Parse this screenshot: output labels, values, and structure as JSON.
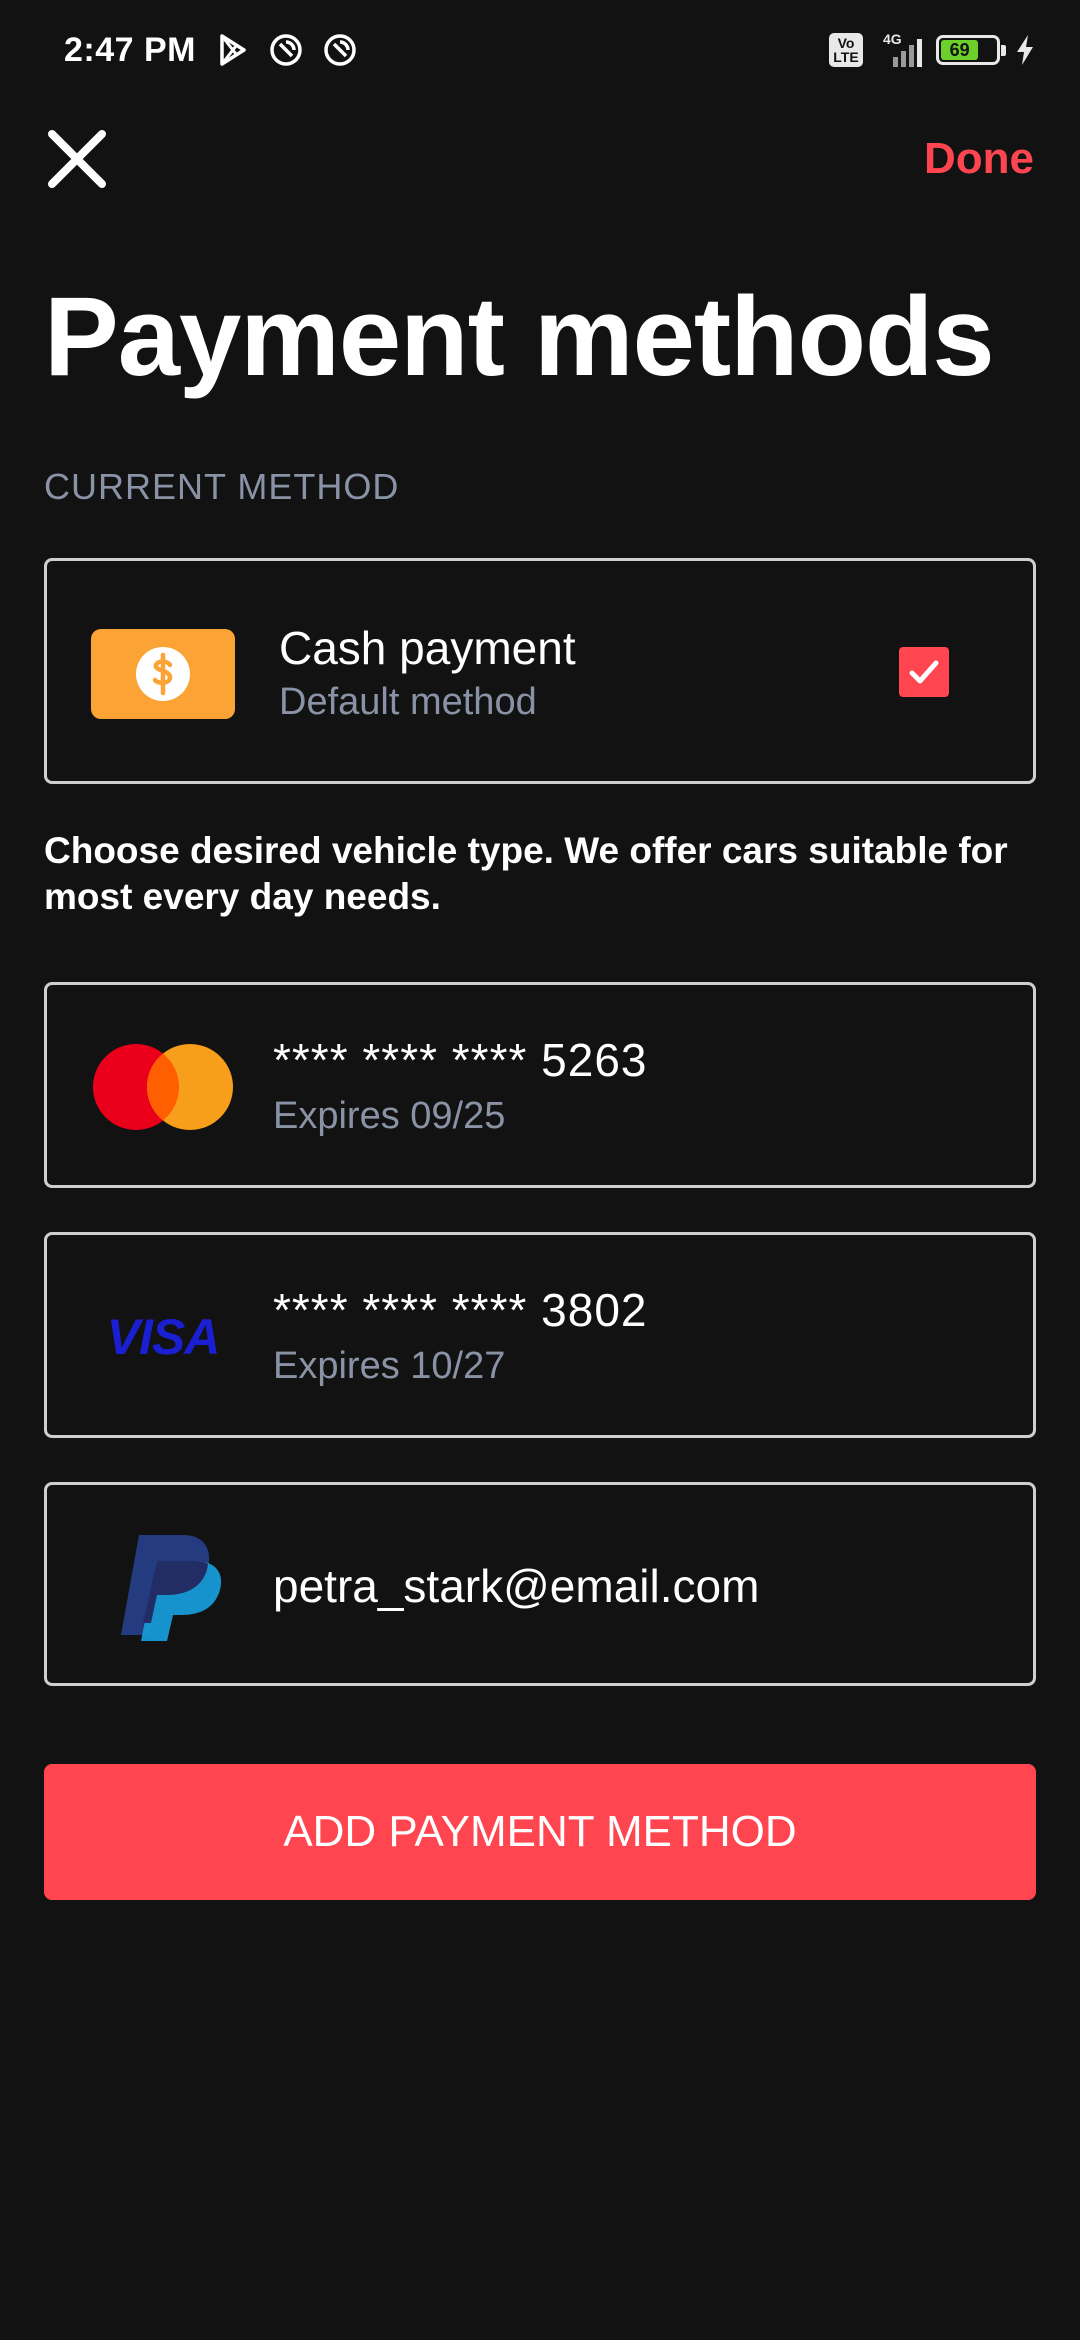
{
  "status_bar": {
    "time": "2:47 PM",
    "network_label": "4G",
    "volte_label": "Vo LTE",
    "battery_level": "69",
    "icons": [
      "play-store-icon",
      "notification-icon",
      "notification-icon",
      "volte-icon",
      "signal-icon",
      "battery-icon",
      "charging-icon"
    ]
  },
  "header": {
    "close_icon": "close-icon",
    "done_label": "Done",
    "title": "Payment methods"
  },
  "current_method": {
    "section_label": "CURRENT METHOD",
    "title": "Cash payment",
    "subtitle": "Default method",
    "selected": true,
    "icon": "dollar-icon"
  },
  "info_text": "Choose desired vehicle type. We offer cars suitable for most every day needs.",
  "methods": [
    {
      "brand": "mastercard",
      "number": "**** **** **** 5263",
      "expiry": "Expires 09/25"
    },
    {
      "brand": "visa",
      "brand_label": "VISA",
      "number": "**** **** **** 3802",
      "expiry": "Expires 10/27"
    },
    {
      "brand": "paypal",
      "email": "petra_stark@email.com"
    }
  ],
  "add_button_label": "ADD PAYMENT METHOD",
  "colors": {
    "background": "#121212",
    "accent": "#ff4550",
    "muted_text": "#8a93a6",
    "cash_orange": "#fba334",
    "visa_blue": "#1a1fd1",
    "paypal_dark": "#253b80",
    "paypal_light": "#179bd7"
  }
}
